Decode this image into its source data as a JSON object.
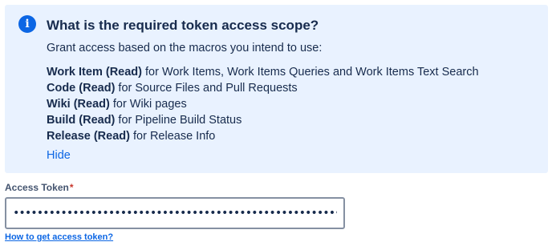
{
  "info_panel": {
    "icon": "info-icon",
    "icon_glyph": "i",
    "title": "What is the required token access scope?",
    "subtitle": "Grant access based on the macros you intend to use:",
    "scopes": [
      {
        "name": "Work Item (Read)",
        "description": " for Work Items, Work Items Queries and Work Items Text Search"
      },
      {
        "name": "Code (Read)",
        "description": " for Source Files and Pull Requests"
      },
      {
        "name": "Wiki (Read)",
        "description": " for Wiki pages"
      },
      {
        "name": "Build (Read)",
        "description": " for Pipeline Build Status"
      },
      {
        "name": "Release (Read)",
        "description": " for Release Info"
      }
    ],
    "hide_label": "Hide"
  },
  "access_token": {
    "label": "Access Token",
    "required_marker": "*",
    "value": "••••••••••••••••••••••••••••••••••••••••••••••••••••••••••••••",
    "help_link": "How to get access token?"
  },
  "colors": {
    "panel_background": "#e9f2ff",
    "icon_background": "#0c66e4",
    "link": "#0c66e4",
    "text": "#172b4d",
    "required": "#c9372c"
  }
}
